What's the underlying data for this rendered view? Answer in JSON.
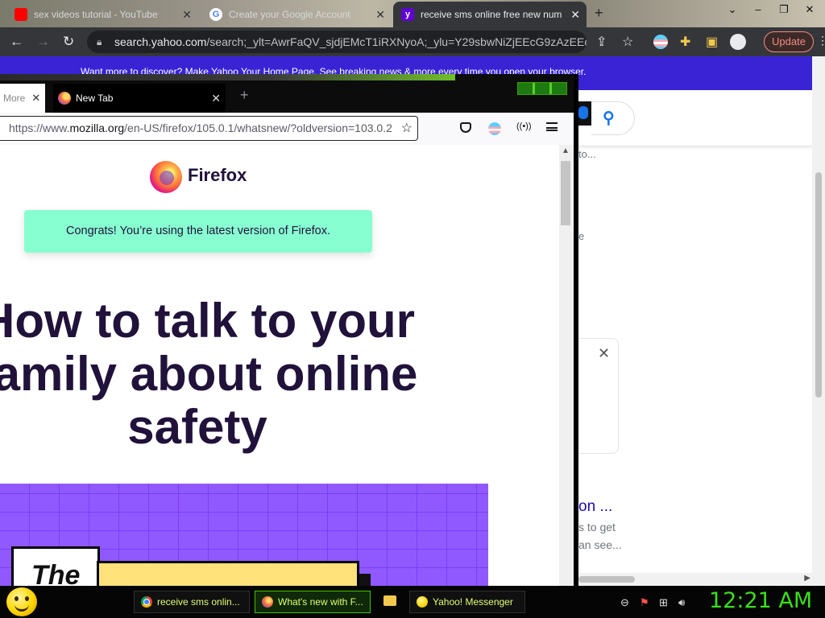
{
  "chrome": {
    "tabs": [
      {
        "title": "sex videos tutorial - YouTube",
        "favicon": "youtube-icon"
      },
      {
        "title": "Create your Google Account",
        "favicon": "google-icon"
      },
      {
        "title": "receive sms online free new num",
        "favicon": "yahoo-icon"
      }
    ],
    "new_tab_symbol": "+",
    "url_host": "search.yahoo.com",
    "url_rest": "/search;_ylt=AwrFaQV_sjdjEMcT1iRXNyoA;_ylu=Y29sbwNiZjEEcG9zAzEEdnR...",
    "update_label": "Update",
    "yahoo_banner": "Want more to discover? Make Yahoo Your Home Page. See breaking news & more every time you open your browser.",
    "results": {
      "snippet1": "to...",
      "snippet2": "e",
      "title": "on ...",
      "line1": "s to get",
      "line2": "an see..."
    }
  },
  "firefox": {
    "tabs": [
      {
        "title": "More"
      },
      {
        "title": "New Tab"
      }
    ],
    "url_prefix": "https://www.",
    "url_domain": "mozilla.org",
    "url_path": "/en-US/firefox/105.0.1/whatsnew/?oldversion=103.0.2",
    "page": {
      "brand": "Firefox",
      "congrats": "Congrats! You’re using the latest version of Firefox.",
      "headline": "How to talk to your family about online safety",
      "promo_word": "The"
    },
    "colors": {
      "congrats_bg": "#88ffd1",
      "headline": "#20123a",
      "promo_bg": "#9059ff"
    }
  },
  "taskbar": {
    "tasks": [
      {
        "label": "receive sms onlin...",
        "icon": "chrome-icon"
      },
      {
        "label": "What's new with F...",
        "icon": "firefox-icon"
      },
      {
        "label": "Yahoo! Messenger",
        "icon": "yahoo-messenger-icon"
      }
    ],
    "clock": "12:21 AM"
  }
}
